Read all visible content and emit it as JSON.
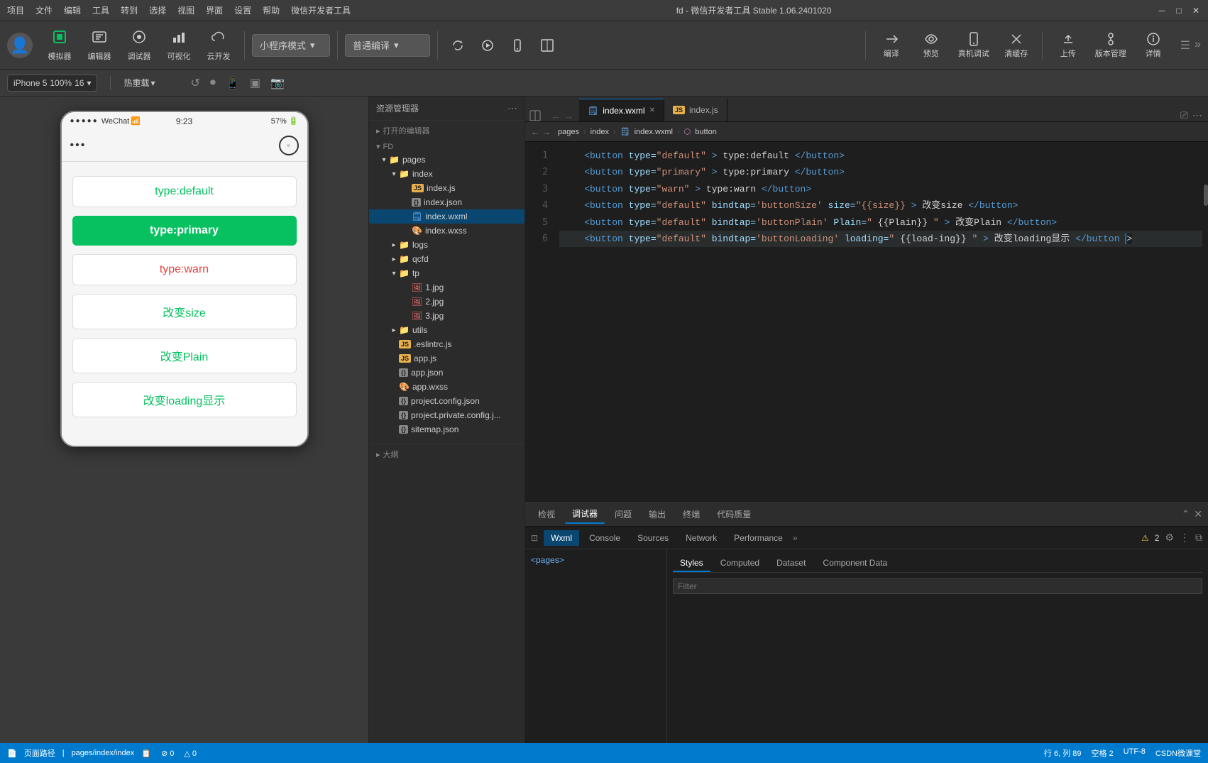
{
  "app": {
    "title": "fd - 微信开发者工具 Stable 1.06.2401020"
  },
  "menu": {
    "items": [
      "项目",
      "文件",
      "编辑",
      "工具",
      "转到",
      "选择",
      "视图",
      "界面",
      "设置",
      "帮助",
      "微信开发者工具"
    ]
  },
  "toolbar": {
    "avatar_emoji": "👤",
    "simulator_label": "模拟器",
    "editor_label": "编辑器",
    "debugger_label": "调试器",
    "visualize_label": "可视化",
    "cloud_label": "云开发",
    "mode_label": "小程序模式",
    "compile_label": "普通编译",
    "compile_btn": "编译",
    "preview_btn": "预览",
    "real_test_btn": "真机调试",
    "clear_btn": "清缓存",
    "upload_btn": "上传",
    "version_btn": "版本管理",
    "detail_btn": "详情"
  },
  "device_bar": {
    "device": "iPhone 5",
    "zoom": "100%",
    "dpr": "16",
    "hot_reload": "热重载",
    "chevron": "▾"
  },
  "simulator": {
    "status_bar": {
      "dots": "●●●●●",
      "carrier": "WeChat",
      "wifi_icon": "📶",
      "time": "9:23",
      "battery": "57%"
    },
    "buttons": [
      {
        "label": "type:default",
        "style": "default"
      },
      {
        "label": "type:primary",
        "style": "primary"
      },
      {
        "label": "type:warn",
        "style": "warn"
      },
      {
        "label": "改变size",
        "style": "size"
      },
      {
        "label": "改变Plain",
        "style": "plain"
      },
      {
        "label": "改变loading显示",
        "style": "loading"
      }
    ]
  },
  "file_tree": {
    "header": "资源管理器",
    "open_editors": "打开的编辑器",
    "root": "FD",
    "items": [
      {
        "name": "pages",
        "type": "folder",
        "expanded": true,
        "level": 1
      },
      {
        "name": "index",
        "type": "folder",
        "expanded": true,
        "level": 2
      },
      {
        "name": "index.js",
        "type": "js",
        "level": 3
      },
      {
        "name": "index.json",
        "type": "json",
        "level": 3
      },
      {
        "name": "index.wxml",
        "type": "wxml",
        "level": 3,
        "selected": true
      },
      {
        "name": "index.wxss",
        "type": "wxss",
        "level": 3
      },
      {
        "name": "logs",
        "type": "folder",
        "expanded": false,
        "level": 2
      },
      {
        "name": "qcfd",
        "type": "folder",
        "expanded": false,
        "level": 2
      },
      {
        "name": "tp",
        "type": "folder",
        "expanded": true,
        "level": 2
      },
      {
        "name": "1.jpg",
        "type": "img",
        "level": 3
      },
      {
        "name": "2.jpg",
        "type": "img",
        "level": 3
      },
      {
        "name": "3.jpg",
        "type": "img",
        "level": 3
      },
      {
        "name": "utils",
        "type": "folder",
        "expanded": false,
        "level": 2
      },
      {
        "name": ".eslintrc.js",
        "type": "js",
        "level": 2
      },
      {
        "name": "app.js",
        "type": "js",
        "level": 2
      },
      {
        "name": "app.json",
        "type": "json",
        "level": 2
      },
      {
        "name": "app.wxss",
        "type": "wxss",
        "level": 2
      },
      {
        "name": "project.config.json",
        "type": "json",
        "level": 2
      },
      {
        "name": "project.private.config.j...",
        "type": "json",
        "level": 2
      },
      {
        "name": "sitemap.json",
        "type": "json",
        "level": 2
      }
    ]
  },
  "editor": {
    "tabs": [
      {
        "name": "index.wxml",
        "icon": "🗒",
        "active": true
      },
      {
        "name": "index.js",
        "icon": "JS",
        "active": false
      }
    ],
    "breadcrumb": [
      "pages",
      "index",
      "index.wxml",
      "button"
    ],
    "lines": [
      {
        "num": 1,
        "content": "    <button type=\"default\">type:default</button>"
      },
      {
        "num": 2,
        "content": "    <button type=\"primary\">type:primary</button>"
      },
      {
        "num": 3,
        "content": "    <button type=\"warn\">type:warn</button>"
      },
      {
        "num": 4,
        "content": "    <button type=\"default\"bindtap='buttonSize'size=\"{{size}}\">改变size</button>"
      },
      {
        "num": 5,
        "content": "    <button type=\"default\"bindtap='buttonPlain'Plain=\"{{Plain}}\">改变Plain</button>"
      },
      {
        "num": 6,
        "content": "    <button type=\"default\"bindtap='buttonLoading'loading=\"{{load-ing}}\">改变loading显示</button>",
        "highlighted": true
      }
    ]
  },
  "devtools": {
    "top_tabs": [
      "检视",
      "调试器",
      "问题",
      "输出",
      "终端",
      "代码质量"
    ],
    "active_top_tab": "调试器",
    "badge_count": "2",
    "inner_tabs": [
      "Wxml",
      "Console",
      "Sources",
      "Network",
      "Performance"
    ],
    "active_inner_tab": "Wxml",
    "warning_count": "2",
    "style_tabs": [
      "Styles",
      "Computed",
      "Dataset",
      "Component Data"
    ],
    "active_style_tab": "Styles",
    "filter_placeholder": "Filter",
    "wxml_path": "<pages>"
  },
  "status_bar": {
    "page_path": "页面路径",
    "separator": "|",
    "page": "pages/index/index",
    "file_icon": "📄",
    "errors": "⊘ 0",
    "warnings": "△ 0",
    "right": {
      "line_col": "行 6, 列 89",
      "spaces": "空格 2",
      "encoding": "UTF-8",
      "lang": "CSDN微课堂"
    }
  },
  "colors": {
    "primary_green": "#07c160",
    "warn_red": "#e64340",
    "accent_blue": "#007acc",
    "bg_dark": "#1e1e1e",
    "bg_medium": "#2d2d2d",
    "bg_light": "#3a3a3a",
    "text_light": "#d4d4d4",
    "text_dim": "#888"
  }
}
